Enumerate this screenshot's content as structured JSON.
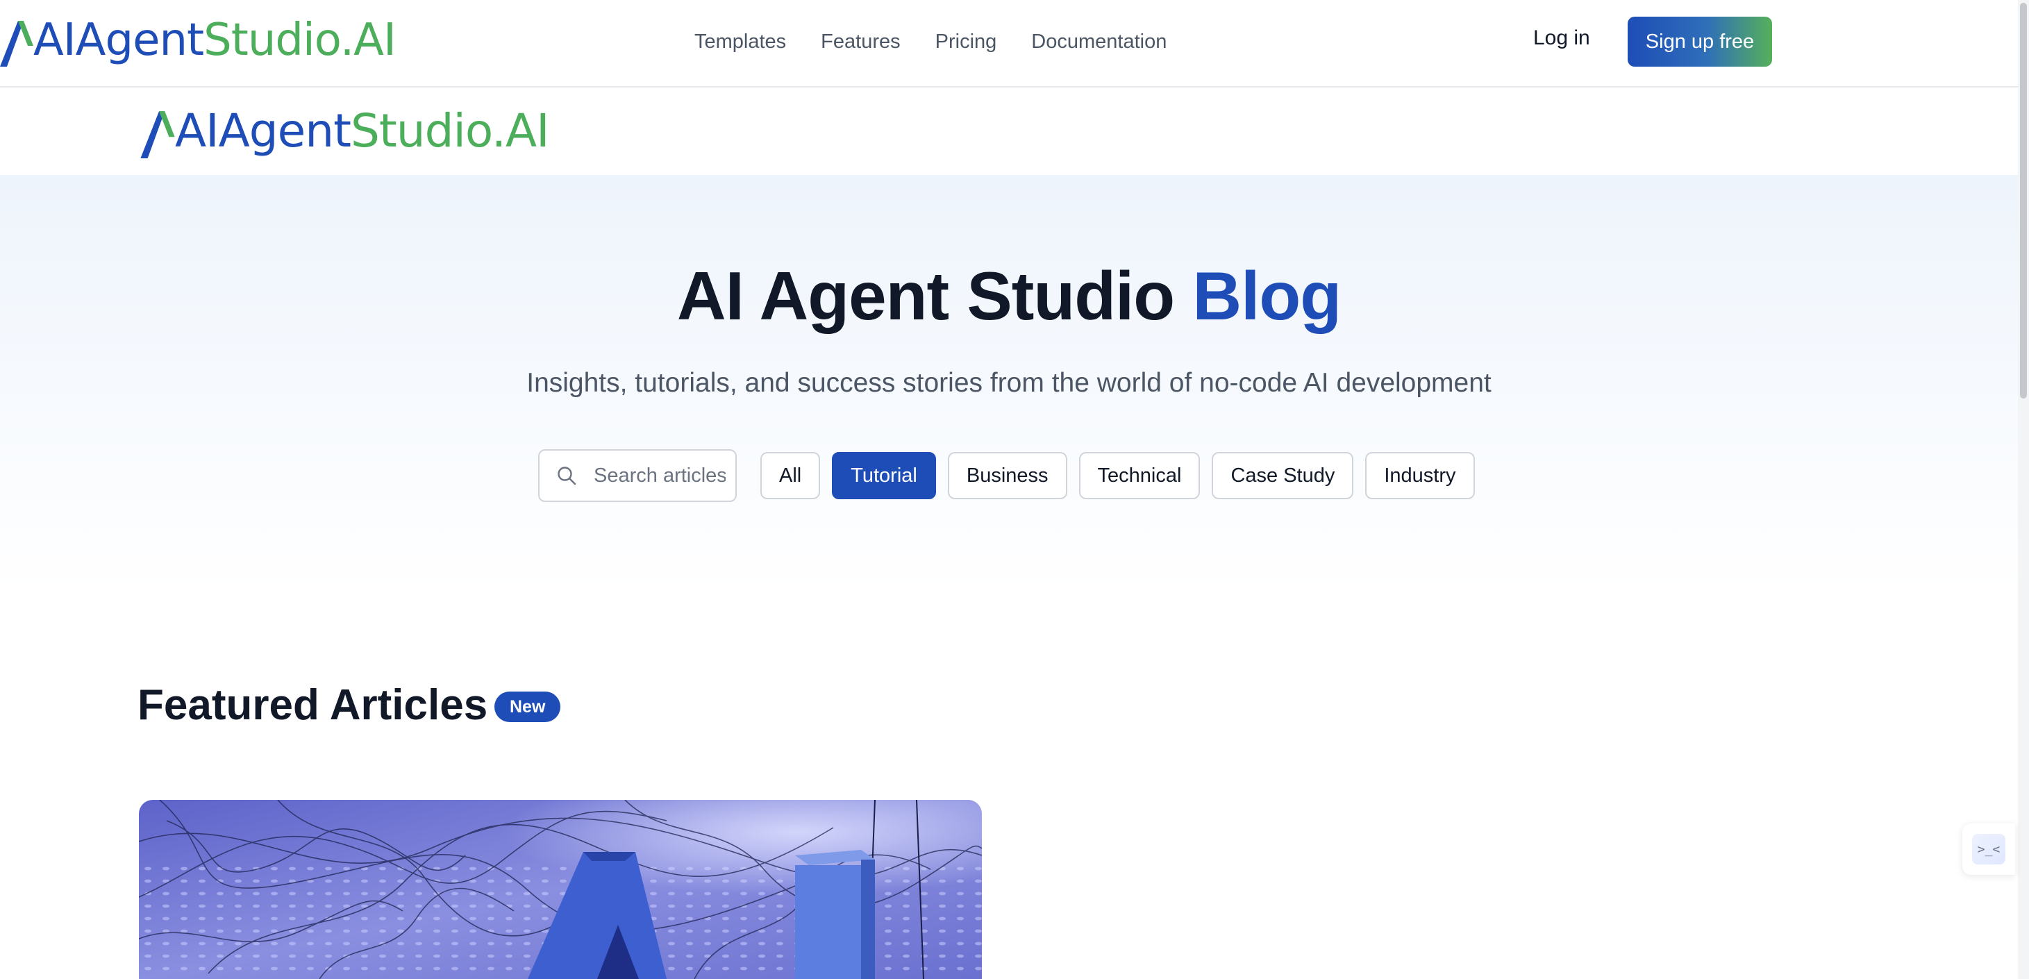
{
  "brand": {
    "logo_text_ai": "AI",
    "logo_text_agent": "Agent",
    "logo_text_studio": "Studio.AI"
  },
  "nav": {
    "links": [
      "Templates",
      "Features",
      "Pricing",
      "Documentation"
    ],
    "login": "Log in",
    "signup": "Sign up free"
  },
  "hero": {
    "title_main": "AI Agent Studio",
    "title_accent": "Blog",
    "subtitle": "Insights, tutorials, and success stories from the world of no-code AI development",
    "search_placeholder": "Search articles...",
    "categories": [
      "All",
      "Tutorial",
      "Business",
      "Technical",
      "Case Study",
      "Industry"
    ],
    "active_category": "Tutorial"
  },
  "featured": {
    "title": "Featured Articles",
    "badge": "New"
  },
  "widget": {
    "glyph": ">_<"
  },
  "colors": {
    "brand_blue": "#1e4db7",
    "brand_green": "#4cae5b",
    "hero_bg": "#eef4fc"
  }
}
